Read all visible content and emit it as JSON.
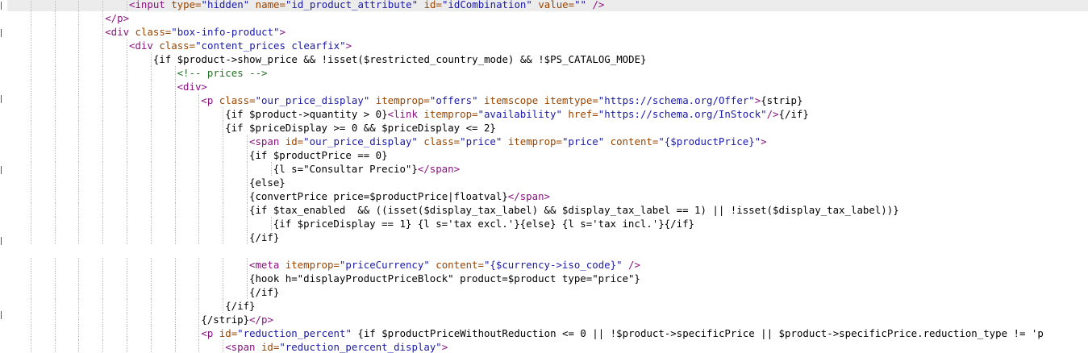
{
  "editor": {
    "lines": [
      {
        "indent": 5,
        "tokens": [
          {
            "t": "<input ",
            "k": "tag"
          },
          {
            "t": "type=",
            "k": "attr"
          },
          {
            "t": "\"hidden\" ",
            "k": "val"
          },
          {
            "t": "name=",
            "k": "attr"
          },
          {
            "t": "\"id_product_attribute\" ",
            "k": "val"
          },
          {
            "t": "id=",
            "k": "attr"
          },
          {
            "t": "\"idCombination\" ",
            "k": "val"
          },
          {
            "t": "value=",
            "k": "attr"
          },
          {
            "t": "\"\" ",
            "k": "val"
          },
          {
            "t": "/>",
            "k": "tag"
          }
        ]
      },
      {
        "indent": 4,
        "tokens": [
          {
            "t": "</p>",
            "k": "tag"
          }
        ]
      },
      {
        "indent": 4,
        "tokens": [
          {
            "t": "<div ",
            "k": "tag"
          },
          {
            "t": "class=",
            "k": "attr"
          },
          {
            "t": "\"box-info-product\"",
            "k": "val"
          },
          {
            "t": ">",
            "k": "tag"
          }
        ]
      },
      {
        "indent": 5,
        "tokens": [
          {
            "t": "<div ",
            "k": "tag"
          },
          {
            "t": "class=",
            "k": "attr"
          },
          {
            "t": "\"content_prices clearfix\"",
            "k": "val"
          },
          {
            "t": ">",
            "k": "tag"
          }
        ]
      },
      {
        "indent": 6,
        "tokens": [
          {
            "t": "{if $product->show_price && !isset($restricted_country_mode) && !$PS_CATALOG_MODE}",
            "k": "txt"
          }
        ]
      },
      {
        "indent": 7,
        "tokens": [
          {
            "t": "<!-- prices -->",
            "k": "cmt"
          }
        ]
      },
      {
        "indent": 7,
        "tokens": [
          {
            "t": "<div>",
            "k": "tag"
          }
        ]
      },
      {
        "indent": 8,
        "tokens": [
          {
            "t": "<p ",
            "k": "tag"
          },
          {
            "t": "class=",
            "k": "attr"
          },
          {
            "t": "\"our_price_display\" ",
            "k": "val"
          },
          {
            "t": "itemprop=",
            "k": "attr"
          },
          {
            "t": "\"offers\" ",
            "k": "val"
          },
          {
            "t": "itemscope ",
            "k": "attr"
          },
          {
            "t": "itemtype=",
            "k": "attr"
          },
          {
            "t": "\"https://schema.org/Offer\"",
            "k": "val"
          },
          {
            "t": ">",
            "k": "tag"
          },
          {
            "t": "{strip}",
            "k": "txt"
          }
        ]
      },
      {
        "indent": 9,
        "tokens": [
          {
            "t": "{if $product->quantity > 0}",
            "k": "txt"
          },
          {
            "t": "<link ",
            "k": "tag"
          },
          {
            "t": "itemprop=",
            "k": "attr"
          },
          {
            "t": "\"availability\" ",
            "k": "val"
          },
          {
            "t": "href=",
            "k": "attr"
          },
          {
            "t": "\"https://schema.org/InStock\"",
            "k": "val"
          },
          {
            "t": "/>",
            "k": "tag"
          },
          {
            "t": "{/if}",
            "k": "txt"
          }
        ]
      },
      {
        "indent": 9,
        "tokens": [
          {
            "t": "{if $priceDisplay >= 0 && $priceDisplay <= 2}",
            "k": "txt"
          }
        ]
      },
      {
        "indent": 10,
        "tokens": [
          {
            "t": "<span ",
            "k": "tag"
          },
          {
            "t": "id=",
            "k": "attr"
          },
          {
            "t": "\"our_price_display\" ",
            "k": "val"
          },
          {
            "t": "class=",
            "k": "attr"
          },
          {
            "t": "\"price\" ",
            "k": "val"
          },
          {
            "t": "itemprop=",
            "k": "attr"
          },
          {
            "t": "\"price\" ",
            "k": "val"
          },
          {
            "t": "content=",
            "k": "attr"
          },
          {
            "t": "\"{$productPrice}\"",
            "k": "val"
          },
          {
            "t": ">",
            "k": "tag"
          }
        ]
      },
      {
        "indent": 10,
        "tokens": [
          {
            "t": "{if $productPrice == 0}",
            "k": "txt"
          }
        ]
      },
      {
        "indent": 11,
        "tokens": [
          {
            "t": "{l s=\"Consultar Precio\"}",
            "k": "txt"
          },
          {
            "t": "</span>",
            "k": "tag"
          }
        ]
      },
      {
        "indent": 10,
        "tokens": [
          {
            "t": "{else}",
            "k": "txt"
          }
        ]
      },
      {
        "indent": 10,
        "tokens": [
          {
            "t": "{convertPrice price=$productPrice|floatval}",
            "k": "txt"
          },
          {
            "t": "</span>",
            "k": "tag"
          }
        ]
      },
      {
        "indent": 10,
        "tokens": [
          {
            "t": "{if $tax_enabled  && ((isset($display_tax_label) && $display_tax_label == 1) || !isset($display_tax_label))}",
            "k": "txt"
          }
        ]
      },
      {
        "indent": 11,
        "tokens": [
          {
            "t": "{if $priceDisplay == 1} {l s='tax excl.'}{else} {l s='tax incl.'}{/if}",
            "k": "txt"
          }
        ]
      },
      {
        "indent": 10,
        "tokens": [
          {
            "t": "{/if}",
            "k": "txt"
          }
        ]
      },
      {
        "indent": 0,
        "tokens": []
      },
      {
        "indent": 10,
        "tokens": [
          {
            "t": "<meta ",
            "k": "tag"
          },
          {
            "t": "itemprop=",
            "k": "attr"
          },
          {
            "t": "\"priceCurrency\" ",
            "k": "val"
          },
          {
            "t": "content=",
            "k": "attr"
          },
          {
            "t": "\"{$currency->iso_code}\" ",
            "k": "val"
          },
          {
            "t": "/>",
            "k": "tag"
          }
        ]
      },
      {
        "indent": 10,
        "tokens": [
          {
            "t": "{hook h=\"displayProductPriceBlock\" product=$product type=\"price\"}",
            "k": "txt"
          }
        ]
      },
      {
        "indent": 10,
        "tokens": [
          {
            "t": "{/if}",
            "k": "txt"
          }
        ]
      },
      {
        "indent": 9,
        "tokens": [
          {
            "t": "{/if}",
            "k": "txt"
          }
        ]
      },
      {
        "indent": 8,
        "tokens": [
          {
            "t": "{/strip}",
            "k": "txt"
          },
          {
            "t": "</p>",
            "k": "tag"
          }
        ]
      },
      {
        "indent": 8,
        "tokens": [
          {
            "t": "<p ",
            "k": "tag"
          },
          {
            "t": "id=",
            "k": "attr"
          },
          {
            "t": "\"reduction_percent\" ",
            "k": "val"
          },
          {
            "t": "{if $productPriceWithoutReduction <= 0 || !$product->specificPrice || $product->specificPrice.reduction_type != 'p",
            "k": "txt"
          }
        ]
      },
      {
        "indent": 9,
        "tokens": [
          {
            "t": "<span ",
            "k": "tag"
          },
          {
            "t": "id=",
            "k": "attr"
          },
          {
            "t": "\"reduction_percent_display\"",
            "k": "val"
          },
          {
            "t": ">",
            "k": "tag"
          }
        ]
      }
    ]
  },
  "colors": {
    "tag": "#881280",
    "attribute": "#994500",
    "string": "#1a1aa6",
    "comment": "#236e25",
    "text": "#000000",
    "current_line": "#ececec"
  }
}
